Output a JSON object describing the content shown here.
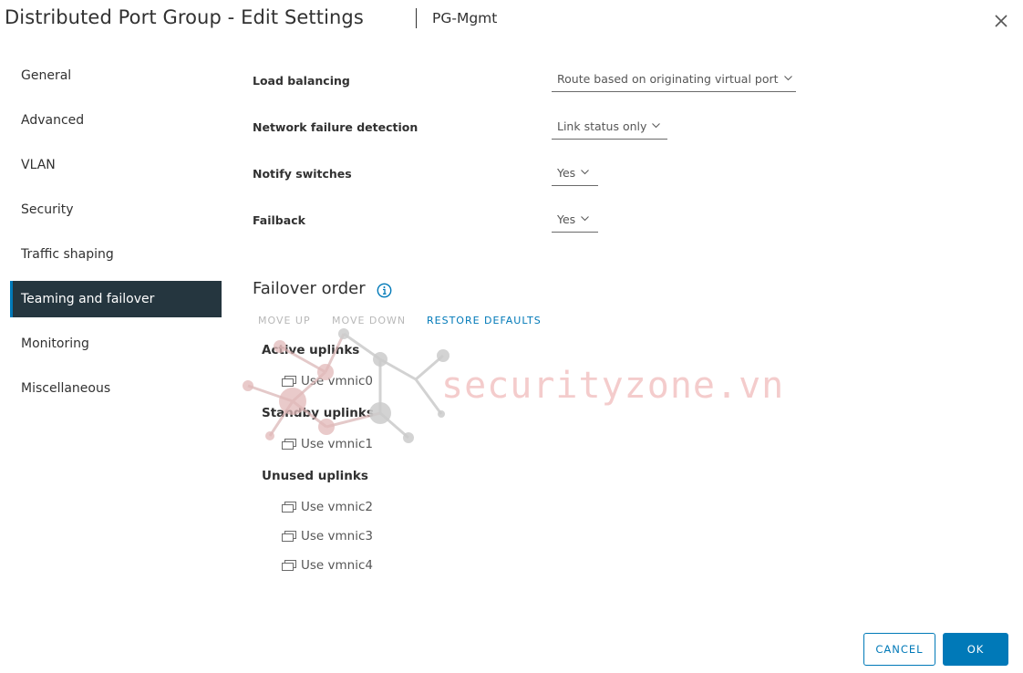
{
  "header": {
    "title": "Distributed Port Group - Edit Settings",
    "subtitle": "PG-Mgmt",
    "close_icon": "close-icon"
  },
  "nav": {
    "items": [
      {
        "label": "General",
        "active": false
      },
      {
        "label": "Advanced",
        "active": false
      },
      {
        "label": "VLAN",
        "active": false
      },
      {
        "label": "Security",
        "active": false
      },
      {
        "label": "Traffic shaping",
        "active": false
      },
      {
        "label": "Teaming and failover",
        "active": true
      },
      {
        "label": "Monitoring",
        "active": false
      },
      {
        "label": "Miscellaneous",
        "active": false
      }
    ]
  },
  "settings": {
    "load_balancing": {
      "label": "Load balancing",
      "value": "Route based on originating virtual port"
    },
    "network_failure_detection": {
      "label": "Network failure detection",
      "value": "Link status only"
    },
    "notify_switches": {
      "label": "Notify switches",
      "value": "Yes"
    },
    "failback": {
      "label": "Failback",
      "value": "Yes"
    }
  },
  "failover": {
    "title": "Failover order",
    "info_icon": "info-icon",
    "toolbar": {
      "move_up": "MOVE UP",
      "move_down": "MOVE DOWN",
      "restore_defaults": "RESTORE DEFAULTS"
    },
    "groups": {
      "active": {
        "label": "Active uplinks",
        "uplinks": [
          "Use vmnic0"
        ]
      },
      "standby": {
        "label": "Standby uplinks",
        "uplinks": [
          "Use vmnic1"
        ]
      },
      "unused": {
        "label": "Unused uplinks",
        "uplinks": [
          "Use vmnic2",
          "Use vmnic3",
          "Use vmnic4"
        ]
      }
    }
  },
  "watermark": {
    "text": "securityzone.vn"
  },
  "footer": {
    "cancel_label": "CANCEL",
    "ok_label": "OK"
  },
  "colors": {
    "accent": "#0079b8",
    "nav_active_bg": "#25363f",
    "text": "#313131",
    "disabled": "#b8b8b8"
  }
}
